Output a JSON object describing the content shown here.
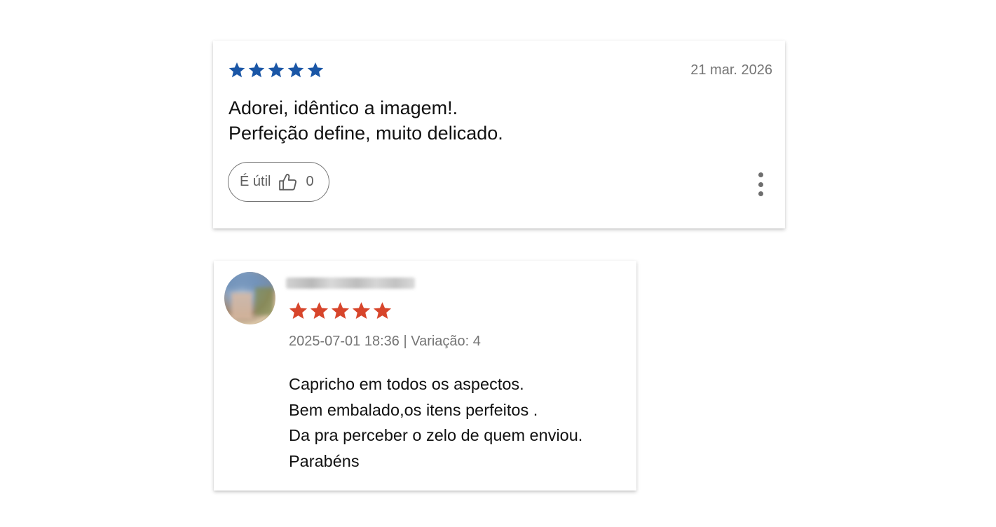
{
  "review_card_1": {
    "rating": 5,
    "star_color": "#1a56a6",
    "date": "21 mar. 2026",
    "text_lines": [
      "Adorei, idêntico a imagem!.",
      "Perfeição define, muito delicado."
    ],
    "helpful_label": "É útil",
    "helpful_count": "0"
  },
  "review_card_2": {
    "rating": 5,
    "star_color": "#d7452b",
    "meta": "2025-07-01 18:36 | Variação: 4",
    "text_lines": [
      "Capricho em todos os aspectos.",
      "Bem embalado,os itens perfeitos .",
      "Da pra perceber o zelo de quem enviou.",
      "Parabéns"
    ]
  },
  "icons": {
    "star": "star-icon",
    "thumbs_up": "thumbs-up-icon",
    "more": "more-vertical-icon"
  }
}
